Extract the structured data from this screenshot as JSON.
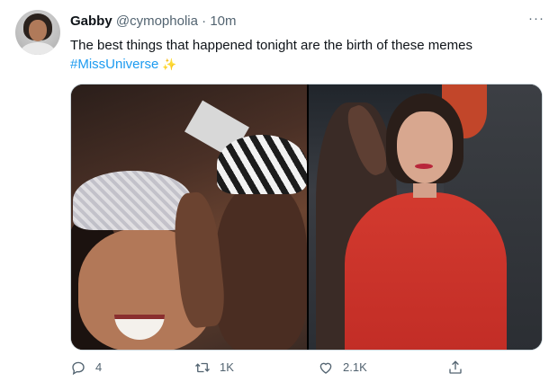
{
  "author": {
    "name": "Gabby",
    "handle": "@cymopholia",
    "separator": "·",
    "time": "10m"
  },
  "tweet": {
    "text": "The best things that happened tonight are the birth of these memes",
    "hashtag": "#MissUniverse",
    "emoji": "✨"
  },
  "menu": {
    "icon": "more-options-icon",
    "glyph": "···"
  },
  "media": {
    "images": [
      {
        "icon": "crowning-photo"
      },
      {
        "icon": "red-dress-photo"
      }
    ]
  },
  "actions": {
    "reply": {
      "icon": "reply-icon",
      "count": "4"
    },
    "retweet": {
      "icon": "retweet-icon",
      "count": "1K"
    },
    "like": {
      "icon": "heart-icon",
      "count": "2.1K"
    },
    "share": {
      "icon": "share-icon",
      "count": ""
    }
  },
  "colors": {
    "accent": "#1d9bf0",
    "text": "#0f1419",
    "secondary": "#536471",
    "border": "#cfd9de"
  }
}
